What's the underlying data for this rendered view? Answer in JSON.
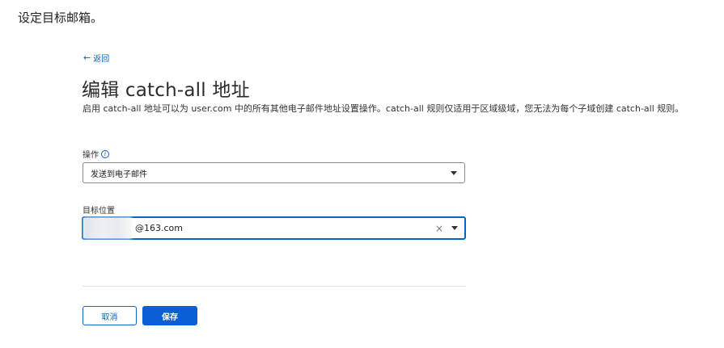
{
  "caption": "设定目标邮箱。",
  "back_link": {
    "arrow": "←",
    "label": "返回"
  },
  "page_title": "编辑 catch-all 地址",
  "description": "启用 catch-all 地址可以为 user.com 中的所有其他电子邮件地址设置操作。catch-all 规则仅适用于区域级域，您无法为每个子域创建 catch-all 规则。",
  "action_field": {
    "label": "操作",
    "selected": "发送到电子邮件",
    "icon": "info-icon"
  },
  "target_field": {
    "label": "目标位置",
    "value": "@163.com",
    "clear": "×"
  },
  "buttons": {
    "cancel": "取消",
    "save": "保存"
  },
  "colors": {
    "accent": "#0b63c4",
    "primary_button": "#0a5fd6"
  }
}
